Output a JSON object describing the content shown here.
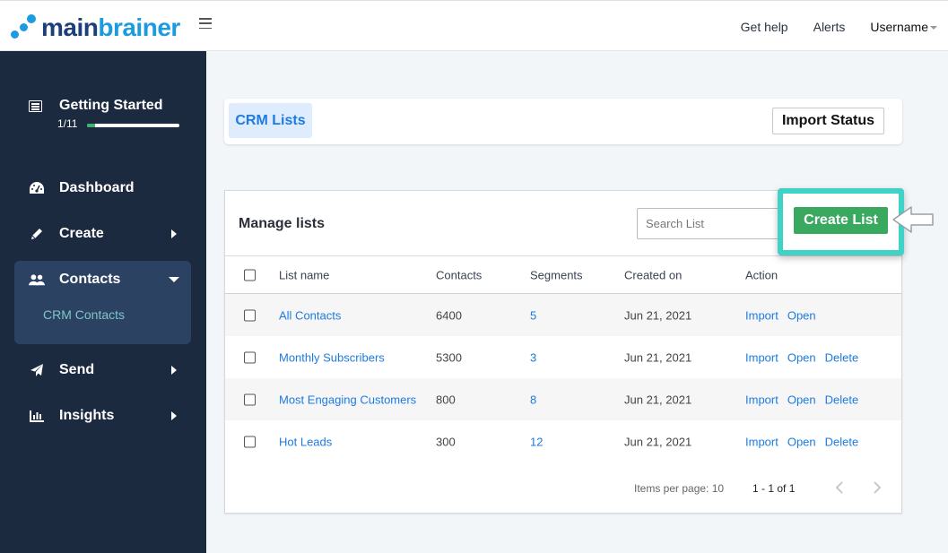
{
  "brand": {
    "name_part1": "main",
    "name_part2": "brainer",
    "colors": {
      "dark": "#1b3f7a",
      "light": "#1d9be0"
    }
  },
  "topnav": {
    "menu_icon": "hamburger-icon",
    "get_help": "Get help",
    "alerts": "Alerts",
    "username": "Username"
  },
  "sidebar": {
    "getting_started": {
      "title": "Getting Started",
      "count": "1/11",
      "progress_fraction": 0.09,
      "icon": "list-icon"
    },
    "items": [
      {
        "label": "Dashboard",
        "icon": "dashboard-gauge-icon",
        "expandable": false
      },
      {
        "label": "Create",
        "icon": "pencil-icon",
        "expandable": true
      },
      {
        "label": "Contacts",
        "icon": "users-icon",
        "expandable": true,
        "expanded": true,
        "children": [
          {
            "label": "CRM Contacts"
          }
        ]
      },
      {
        "label": "Send",
        "icon": "paper-plane-icon",
        "expandable": true
      },
      {
        "label": "Insights",
        "icon": "bar-chart-icon",
        "expandable": true
      }
    ]
  },
  "tabs": {
    "active": "CRM Lists",
    "import_status": "Import Status"
  },
  "manage": {
    "title": "Manage lists",
    "search_placeholder": "Search List",
    "search_value": "",
    "create_button": "Create List",
    "columns": [
      "List name",
      "Contacts",
      "Segments",
      "Created on",
      "Action"
    ],
    "rows": [
      {
        "name": "All Contacts",
        "contacts": "6400",
        "segments": "5",
        "created": "Jun 21, 2021",
        "actions": [
          "Import",
          "Open"
        ]
      },
      {
        "name": "Monthly Subscribers",
        "contacts": "5300",
        "segments": "3",
        "created": "Jun 21, 2021",
        "actions": [
          "Import",
          "Open",
          "Delete"
        ]
      },
      {
        "name": "Most Engaging Customers",
        "contacts": "800",
        "segments": "8",
        "created": "Jun 21, 2021",
        "actions": [
          "Import",
          "Open",
          "Delete"
        ]
      },
      {
        "name": "Hot Leads",
        "contacts": "300",
        "segments": "12",
        "created": "Jun 21, 2021",
        "actions": [
          "Import",
          "Open",
          "Delete"
        ]
      }
    ],
    "pagination": {
      "items_per_page": "Items per page: 10",
      "range": "1 - 1 of 1"
    }
  },
  "colors": {
    "sidebar_bg": "#1c2a40",
    "accent_blue": "#1e7be0",
    "create_green": "#3aa960",
    "highlight_teal": "#3fd2c7",
    "progress_green": "#3cb46e"
  }
}
